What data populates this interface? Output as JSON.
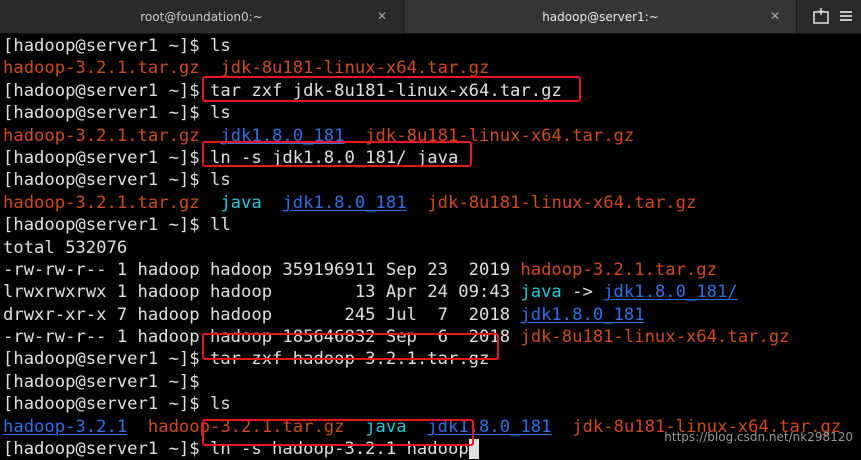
{
  "tabs": [
    {
      "title": "root@foundation0:~"
    },
    {
      "title": "hadoop@server1:~"
    }
  ],
  "terminal": {
    "prompt": "[hadoop@server1 ~]$ ",
    "lines": {
      "l1_cmd": "ls",
      "l2_a": "hadoop-3.2.1.tar.gz",
      "l2_b": "jdk-8u181-linux-x64.tar.gz",
      "l3_cmd": "tar zxf jdk-8u181-linux-x64.tar.gz",
      "l4_cmd": "ls",
      "l5_a": "hadoop-3.2.1.tar.gz",
      "l5_b": "jdk1.8.0_181",
      "l5_c": "jdk-8u181-linux-x64.tar.gz",
      "l6_cmd": "ln -s jdk1.8.0_181/ java",
      "l7_cmd": "ls",
      "l8_a": "hadoop-3.2.1.tar.gz",
      "l8_b": "java",
      "l8_c": "jdk1.8.0_181",
      "l8_d": "jdk-8u181-linux-x64.tar.gz",
      "l9_cmd": "ll",
      "l10": "total 532076",
      "l11_meta": "-rw-rw-r-- 1 hadoop hadoop 359196911 Sep 23  2019 ",
      "l11_name": "hadoop-3.2.1.tar.gz",
      "l12_meta": "lrwxrwxrwx 1 hadoop hadoop        13 Apr 24 09:43 ",
      "l12_name": "java",
      "l12_arrow": " -> ",
      "l12_target": "jdk1.8.0_181/",
      "l13_meta": "drwxr-xr-x 7 hadoop hadoop       245 Jul  7  2018 ",
      "l13_name": "jdk1.8.0_181",
      "l14_meta": "-rw-rw-r-- 1 hadoop hadoop 185646832 Sep  6  2018 ",
      "l14_name": "jdk-8u181-linux-x64.tar.gz",
      "l15_cmd": "tar zxf hadoop-3.2.1.tar.gz",
      "l16_cmd": "",
      "l17_cmd": "ls",
      "l18_a": "hadoop-3.2.1",
      "l18_b": "hadoop-3.2.1.tar.gz",
      "l18_c": "java",
      "l18_d": "jdk1.8.0_181",
      "l18_e": "jdk-8u181-linux-x64.tar.gz",
      "l19_cmd": "ln -s hadoop-3.2.1 hadoop"
    }
  },
  "watermark": "https://blog.csdn.net/nk298120",
  "colors": {
    "background": "#000000",
    "text": "#e0e0e0",
    "archive": "#d24a1c",
    "symlink": "#23c7d9",
    "directory": "#2f70e6",
    "highlight_box": "#e8171d"
  }
}
